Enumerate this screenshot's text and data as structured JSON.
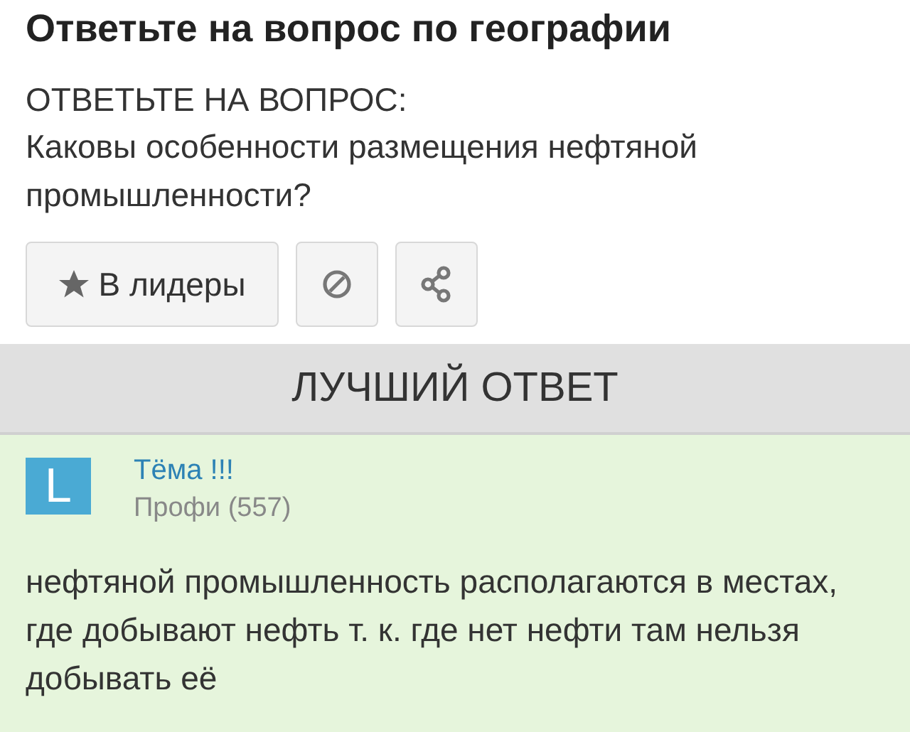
{
  "title": "Ответьте на вопрос по географии",
  "question": {
    "label": "ОТВЕТЬТЕ НА ВОПРОС:",
    "text": "Каковы особенности размещения нефтяной промышленности?"
  },
  "actions": [
    {
      "kind": "leaders",
      "label": "В лидеры"
    },
    {
      "kind": "report"
    },
    {
      "kind": "share"
    }
  ],
  "best_answer": {
    "heading": "ЛУЧШИЙ ОТВЕТ",
    "author": {
      "avatar_letter": "L",
      "name": "Тёма !!!",
      "rank": "Профи (557)"
    },
    "text": "нефтяной промышленность располагаются в местах, где добывают нефть т. к. где нет нефти там нельзя добывать её"
  }
}
